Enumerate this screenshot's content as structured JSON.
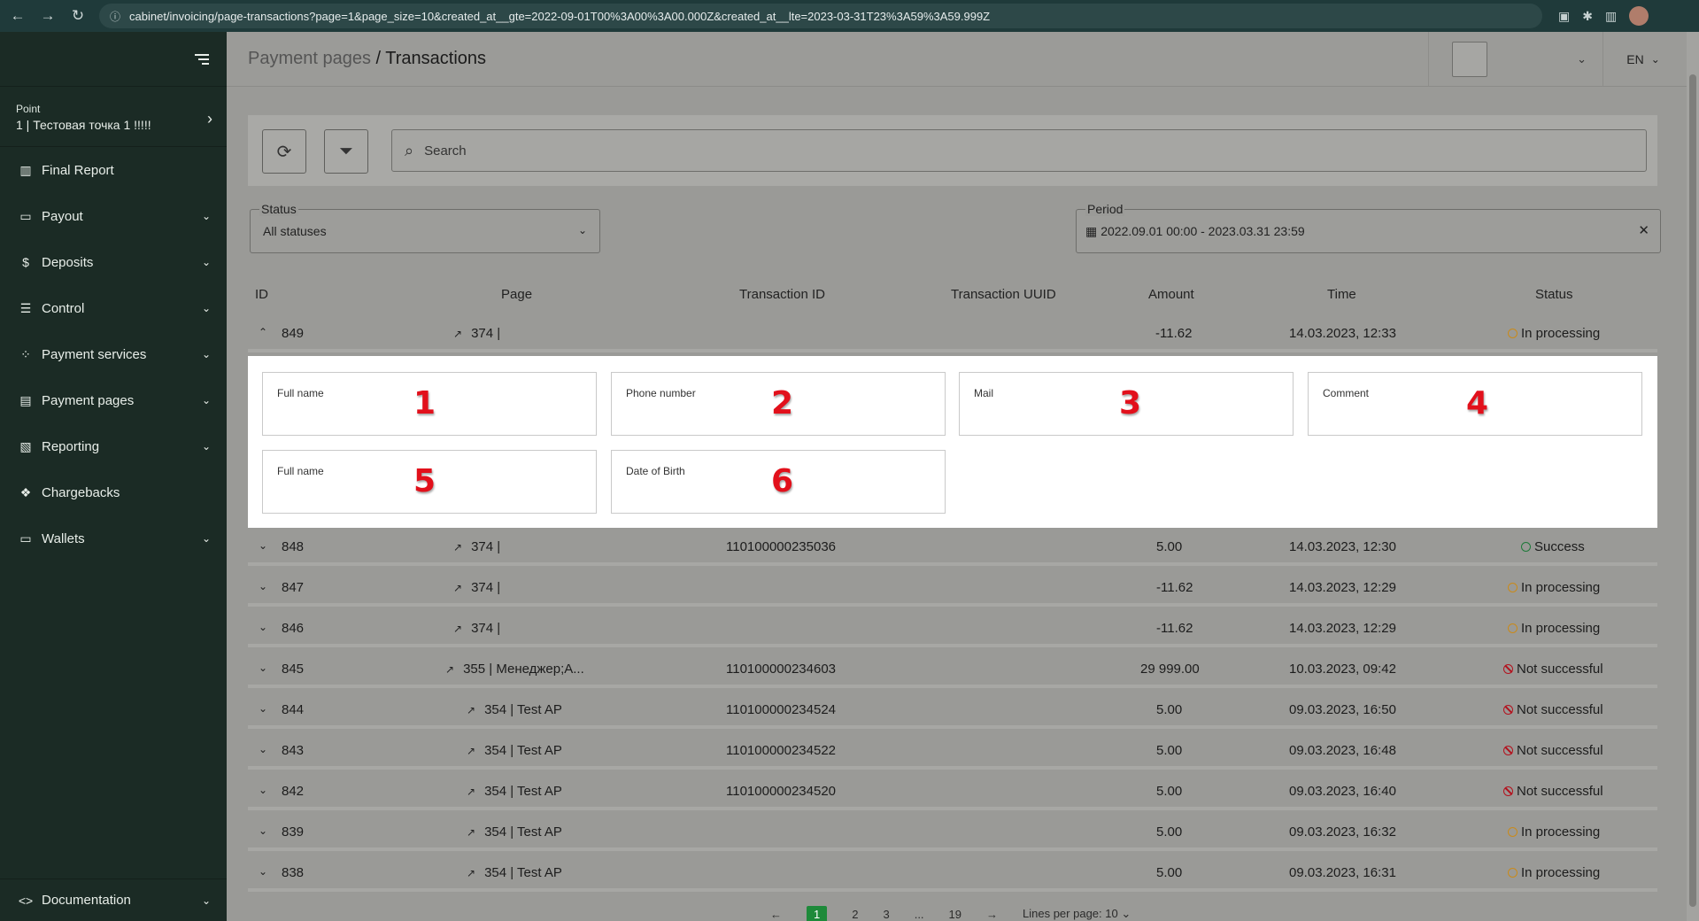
{
  "browser": {
    "url": "cabinet/invoicing/page-transactions?page=1&page_size=10&created_at__gte=2022-09-01T00%3A00%3A00.000Z&created_at__lte=2023-03-31T23%3A59%3A59.999Z"
  },
  "sidebar": {
    "point_label": "Point",
    "point_name": "1 | Тестовая точка 1 !!!!!",
    "items": [
      {
        "label": "Final Report",
        "icon": "bar-chart-icon",
        "has_children": false
      },
      {
        "label": "Payout",
        "icon": "card-icon",
        "has_children": true
      },
      {
        "label": "Deposits",
        "icon": "dollar-icon",
        "has_children": true
      },
      {
        "label": "Control",
        "icon": "sliders-icon",
        "has_children": true
      },
      {
        "label": "Payment services",
        "icon": "grid-icon",
        "has_children": true
      },
      {
        "label": "Payment pages",
        "icon": "page-icon",
        "has_children": true
      },
      {
        "label": "Reporting",
        "icon": "report-icon",
        "has_children": true
      },
      {
        "label": "Chargebacks",
        "icon": "chargeback-icon",
        "has_children": false
      },
      {
        "label": "Wallets",
        "icon": "wallet-icon",
        "has_children": true
      }
    ],
    "bottom_item": {
      "label": "Documentation",
      "icon": "code-icon"
    }
  },
  "header": {
    "breadcrumb_prev": "Payment pages",
    "breadcrumb_sep": " / ",
    "breadcrumb_current": "Transactions",
    "language": "EN"
  },
  "toolbar": {
    "search_placeholder": "Search"
  },
  "filters": {
    "status_label": "Status",
    "status_value": "All statuses",
    "period_label": "Period",
    "period_value": "2022.09.01 00:00 - 2023.03.31 23:59"
  },
  "table": {
    "headers": {
      "id": "ID",
      "page": "Page",
      "transaction_id": "Transaction ID",
      "transaction_uuid": "Transaction UUID",
      "amount": "Amount",
      "time": "Time",
      "status": "Status"
    },
    "expanded_row": {
      "id": "849",
      "page": "374 |",
      "transaction_id": "",
      "amount": "-11.62",
      "time": "14.03.2023, 12:33",
      "status": "In processing",
      "status_type": "processing"
    },
    "expanded_fields": [
      {
        "label": "Full name",
        "number": "1"
      },
      {
        "label": "Phone number",
        "number": "2"
      },
      {
        "label": "Mail",
        "number": "3"
      },
      {
        "label": "Comment",
        "number": "4"
      },
      {
        "label": "Full name",
        "number": "5"
      },
      {
        "label": "Date of Birth",
        "number": "6"
      }
    ],
    "rows": [
      {
        "id": "848",
        "page": "374 |",
        "transaction_id": "110100000235036",
        "amount": "5.00",
        "time": "14.03.2023, 12:30",
        "status": "Success",
        "status_type": "success"
      },
      {
        "id": "847",
        "page": "374 |",
        "transaction_id": "",
        "amount": "-11.62",
        "time": "14.03.2023, 12:29",
        "status": "In processing",
        "status_type": "processing"
      },
      {
        "id": "846",
        "page": "374 |",
        "transaction_id": "",
        "amount": "-11.62",
        "time": "14.03.2023, 12:29",
        "status": "In processing",
        "status_type": "processing"
      },
      {
        "id": "845",
        "page": "355 | Менеджер;A...",
        "transaction_id": "110100000234603",
        "amount": "29 999.00",
        "time": "10.03.2023, 09:42",
        "status": "Not successful",
        "status_type": "fail"
      },
      {
        "id": "844",
        "page": "354 | Test AP",
        "transaction_id": "110100000234524",
        "amount": "5.00",
        "time": "09.03.2023, 16:50",
        "status": "Not successful",
        "status_type": "fail"
      },
      {
        "id": "843",
        "page": "354 | Test AP",
        "transaction_id": "110100000234522",
        "amount": "5.00",
        "time": "09.03.2023, 16:48",
        "status": "Not successful",
        "status_type": "fail"
      },
      {
        "id": "842",
        "page": "354 | Test AP",
        "transaction_id": "110100000234520",
        "amount": "5.00",
        "time": "09.03.2023, 16:40",
        "status": "Not successful",
        "status_type": "fail"
      },
      {
        "id": "839",
        "page": "354 | Test AP",
        "transaction_id": "",
        "amount": "5.00",
        "time": "09.03.2023, 16:32",
        "status": "In processing",
        "status_type": "processing"
      },
      {
        "id": "838",
        "page": "354 | Test AP",
        "transaction_id": "",
        "amount": "5.00",
        "time": "09.03.2023, 16:31",
        "status": "In processing",
        "status_type": "processing"
      }
    ]
  },
  "pagination": {
    "prev": "←",
    "pages": [
      "1",
      "2",
      "3"
    ],
    "ellipsis": "...",
    "last": "19",
    "next": "→",
    "lines_per_page": "Lines per page: 10"
  },
  "colors": {
    "sidebar_bg": "#1b2b25",
    "accent_green": "#1e8a3a",
    "status_processing": "#c98a1a",
    "status_success": "#1f7a3a",
    "status_fail": "#b3121e",
    "annotation_red": "#e2101b"
  }
}
